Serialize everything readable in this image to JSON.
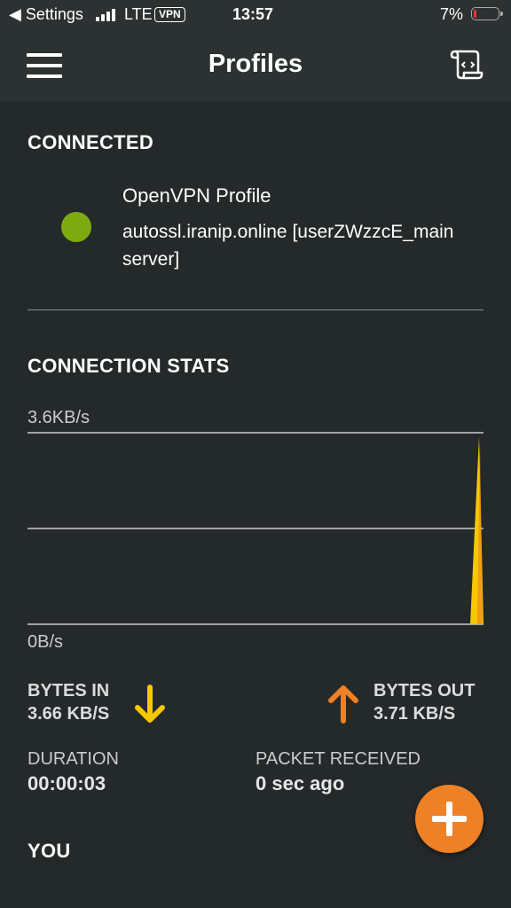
{
  "status_bar": {
    "back_label": "◀ Settings",
    "network": "LTE",
    "vpn": "VPN",
    "time": "13:57",
    "battery": "7%",
    "battery_level": 0.07
  },
  "header": {
    "title": "Profiles",
    "menu_icon": "hamburger-menu-icon",
    "right_icon": "code-script-icon"
  },
  "connected": {
    "section_title": "CONNECTED",
    "status_color": "#7dab0f",
    "profile_name": "OpenVPN Profile",
    "server": "autossl.iranip.online [userZWzzcE_main server]"
  },
  "stats": {
    "section_title": "CONNECTION STATS",
    "graph_max_label": "3.6KB/s",
    "graph_min_label": "0B/s",
    "graph_colors": {
      "in": "#f5c800",
      "out": "#ee8025"
    },
    "bytes_in_label": "BYTES IN",
    "bytes_in_value": "3.66 KB/S",
    "bytes_out_label": "BYTES OUT",
    "bytes_out_value": "3.71 KB/S",
    "duration_label": "DURATION",
    "duration_value": "00:00:03",
    "packet_label": "PACKET RECEIVED",
    "packet_value": "0 sec ago"
  },
  "you": {
    "section_title": "YOU"
  },
  "fab": {
    "icon": "plus-icon",
    "color": "#ee8025"
  }
}
